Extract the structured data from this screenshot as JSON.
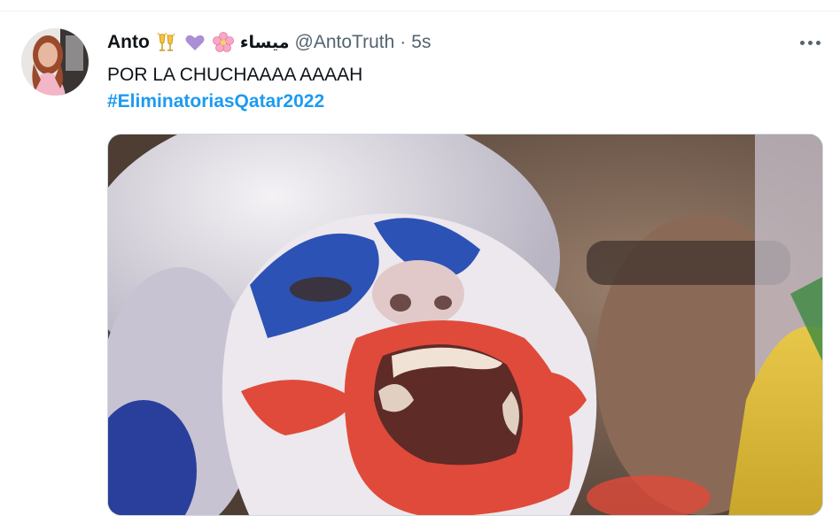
{
  "tweet": {
    "author": {
      "display_name": "Anto",
      "emojis": [
        "clinking-glasses",
        "purple-heart",
        "cherry-blossom"
      ],
      "arabic_name": "ميساء",
      "handle": "@AntoTruth",
      "separator": "·",
      "time": "5s",
      "avatar_icon": "profile-photo"
    },
    "text": "POR LA CHUCHAAAA AAAAH",
    "hashtag": "#EliminatoriasQatar2022",
    "media": {
      "description_icon": "photo-face-painted-fan"
    },
    "colors": {
      "hashtag": "#1d9bf0",
      "secondary_text": "#536471",
      "primary_text": "#0f1419",
      "border": "#cfd9de"
    }
  }
}
